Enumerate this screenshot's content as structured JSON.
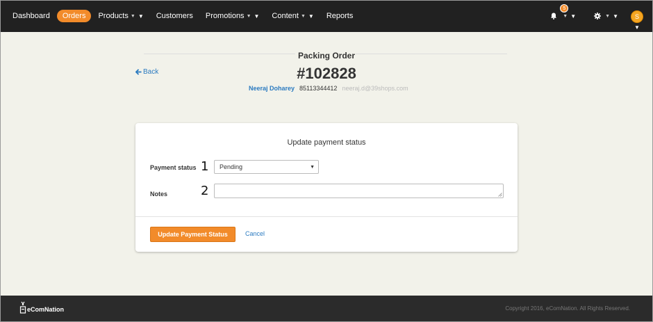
{
  "nav": {
    "items": [
      {
        "label": "Dashboard",
        "active": false,
        "caret": false
      },
      {
        "label": "Orders",
        "active": true,
        "caret": false
      },
      {
        "label": "Products",
        "active": false,
        "caret": true
      },
      {
        "label": "Customers",
        "active": false,
        "caret": false
      },
      {
        "label": "Promotions",
        "active": false,
        "caret": true
      },
      {
        "label": "Content",
        "active": false,
        "caret": true
      },
      {
        "label": "Reports",
        "active": false,
        "caret": false
      }
    ],
    "notifications_count": "5",
    "avatar_initial": "S",
    "icons": {
      "bell": "bell-icon",
      "gear": "gear-icon",
      "caret": "caret-down-icon"
    }
  },
  "header": {
    "section_title": "Packing Order",
    "back_label": "Back",
    "order_number": "#102828",
    "customer_name": "Neeraj Doharey",
    "customer_phone": "85113344412",
    "customer_email": "neeraj.d@39shops.com"
  },
  "form": {
    "title": "Update payment status",
    "payment_status_label": "Payment status",
    "payment_status_marker": "1",
    "payment_status_value": "Pending",
    "notes_label": "Notes",
    "notes_marker": "2",
    "notes_value": "",
    "submit_label": "Update Payment Status",
    "cancel_label": "Cancel"
  },
  "footer": {
    "brand": "eComNation",
    "copyright": "Copyright 2016, eComNation. All Rights Reserved."
  },
  "colors": {
    "accent": "#f28b2a",
    "link": "#2a7ac0",
    "nav_bg": "#212121",
    "page_bg": "#f2f2ea",
    "footer_bg": "#2b2b2b"
  }
}
